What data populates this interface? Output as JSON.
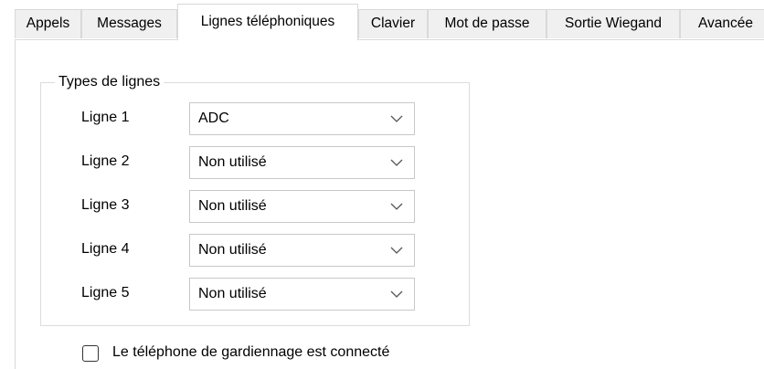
{
  "tabs": [
    {
      "label": "Appels",
      "active": false
    },
    {
      "label": "Messages",
      "active": false
    },
    {
      "label": "Lignes téléphoniques",
      "active": true
    },
    {
      "label": "Clavier",
      "active": false
    },
    {
      "label": "Mot de passe",
      "active": false
    },
    {
      "label": "Sortie Wiegand",
      "active": false
    },
    {
      "label": "Avancée",
      "active": false
    }
  ],
  "line_types": {
    "legend": "Types de lignes",
    "rows": [
      {
        "label": "Ligne 1",
        "value": "ADC"
      },
      {
        "label": "Ligne 2",
        "value": "Non utilisé"
      },
      {
        "label": "Ligne 3",
        "value": "Non utilisé"
      },
      {
        "label": "Ligne 4",
        "value": "Non utilisé"
      },
      {
        "label": "Ligne 5",
        "value": "Non utilisé"
      }
    ]
  },
  "guard_phone": {
    "label": "Le téléphone de gardiennage est connecté",
    "checked": false
  },
  "icons": {
    "combo_arrow": "chevron-down-icon"
  },
  "colors": {
    "tab_inactive_bg": "#f0f0f0",
    "border": "#d9d9d9",
    "background": "#ffffff"
  }
}
